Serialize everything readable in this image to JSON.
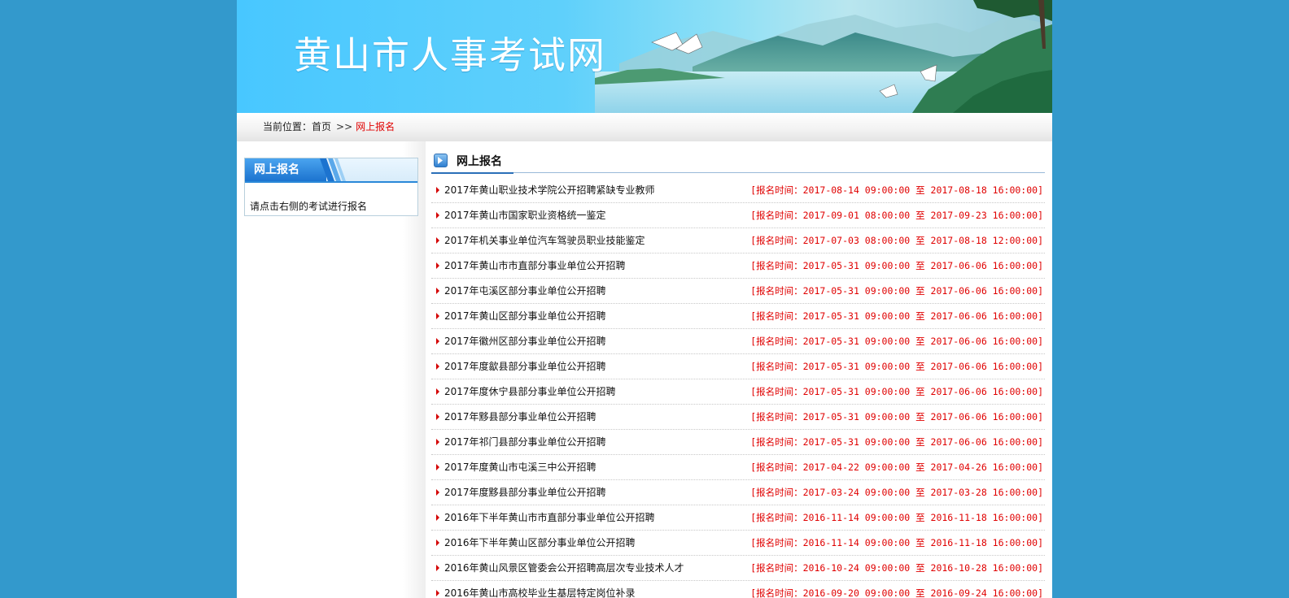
{
  "site": {
    "title": "黄山市人事考试网"
  },
  "breadcrumb": {
    "label": "当前位置：",
    "home": "首页",
    "separator": ">>",
    "current": "网上报名"
  },
  "sidebar": {
    "tab_label": "网上报名",
    "hint": "请点击右侧的考试进行报名"
  },
  "main": {
    "title": "网上报名",
    "exams": [
      {
        "name": "2017年黄山职业技术学院公开招聘紧缺专业教师",
        "time": "[报名时间：2017-08-14 09:00:00 至 2017-08-18 16:00:00]"
      },
      {
        "name": "2017年黄山市国家职业资格统一鉴定",
        "time": "[报名时间：2017-09-01 08:00:00 至 2017-09-23 16:00:00]"
      },
      {
        "name": "2017年机关事业单位汽车驾驶员职业技能鉴定",
        "time": "[报名时间：2017-07-03 08:00:00 至 2017-08-18 12:00:00]"
      },
      {
        "name": "2017年黄山市市直部分事业单位公开招聘",
        "time": "[报名时间：2017-05-31 09:00:00 至 2017-06-06 16:00:00]"
      },
      {
        "name": "2017年屯溪区部分事业单位公开招聘",
        "time": "[报名时间：2017-05-31 09:00:00 至 2017-06-06 16:00:00]"
      },
      {
        "name": "2017年黄山区部分事业单位公开招聘",
        "time": "[报名时间：2017-05-31 09:00:00 至 2017-06-06 16:00:00]"
      },
      {
        "name": "2017年徽州区部分事业单位公开招聘",
        "time": "[报名时间：2017-05-31 09:00:00 至 2017-06-06 16:00:00]"
      },
      {
        "name": "2017年度歙县部分事业单位公开招聘",
        "time": "[报名时间：2017-05-31 09:00:00 至 2017-06-06 16:00:00]"
      },
      {
        "name": "2017年度休宁县部分事业单位公开招聘",
        "time": "[报名时间：2017-05-31 09:00:00 至 2017-06-06 16:00:00]"
      },
      {
        "name": "2017年黟县部分事业单位公开招聘",
        "time": "[报名时间：2017-05-31 09:00:00 至 2017-06-06 16:00:00]"
      },
      {
        "name": "2017年祁门县部分事业单位公开招聘",
        "time": "[报名时间：2017-05-31 09:00:00 至 2017-06-06 16:00:00]"
      },
      {
        "name": "2017年度黄山市屯溪三中公开招聘",
        "time": "[报名时间：2017-04-22 09:00:00 至 2017-04-26 16:00:00]"
      },
      {
        "name": "2017年度黟县部分事业单位公开招聘",
        "time": "[报名时间：2017-03-24 09:00:00 至 2017-03-28 16:00:00]"
      },
      {
        "name": "2016年下半年黄山市市直部分事业单位公开招聘",
        "time": "[报名时间：2016-11-14 09:00:00 至 2016-11-18 16:00:00]"
      },
      {
        "name": "2016年下半年黄山区部分事业单位公开招聘",
        "time": "[报名时间：2016-11-14 09:00:00 至 2016-11-18 16:00:00]"
      },
      {
        "name": "2016年黄山风景区管委会公开招聘高层次专业技术人才",
        "time": "[报名时间：2016-10-24 09:00:00 至 2016-10-28 16:00:00]"
      },
      {
        "name": "2016年黄山市高校毕业生基层特定岗位补录",
        "time": "[报名时间：2016-09-20 09:00:00 至 2016-09-24 16:00:00]"
      }
    ]
  },
  "colors": {
    "page_background": "#3399cc",
    "accent_red": "#e00000",
    "tab_blue": "#1c73cf"
  },
  "icons": {
    "breadcrumb_separator": "double-chevron-right-icon",
    "section_title": "arrow-right-square-icon",
    "list_bullet": "triangle-right-icon"
  }
}
